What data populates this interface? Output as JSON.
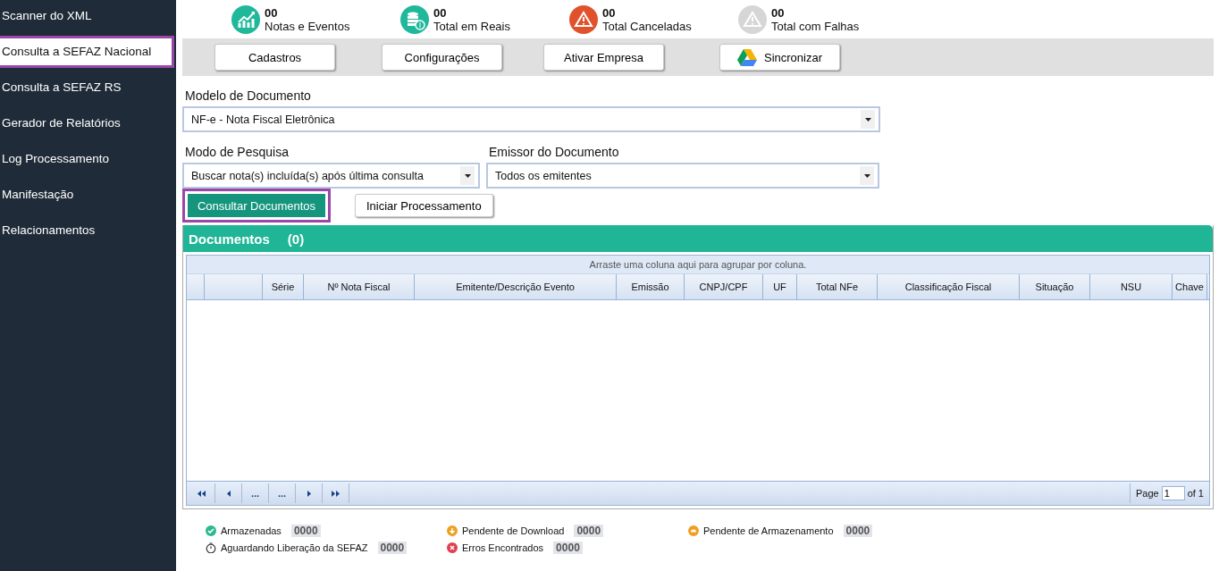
{
  "sidebar": {
    "items": [
      {
        "label": "Scanner do XML",
        "selected": false
      },
      {
        "label": "Consulta a SEFAZ Nacional",
        "selected": true
      },
      {
        "label": "Consulta a SEFAZ RS",
        "selected": false
      },
      {
        "label": "Gerador de Relatórios",
        "selected": false
      },
      {
        "label": "Log Processamento",
        "selected": false
      },
      {
        "label": "Manifestação",
        "selected": false
      },
      {
        "label": "Relacionamentos",
        "selected": false
      }
    ]
  },
  "stats": [
    {
      "kind": "chart",
      "value": "00",
      "label": "Notas e Eventos",
      "color": "#1fb89a"
    },
    {
      "kind": "coins",
      "value": "00",
      "label": "Total em Reais",
      "color": "#1fb89a"
    },
    {
      "kind": "warning",
      "value": "00",
      "label": "Total Canceladas",
      "color": "#e0522b"
    },
    {
      "kind": "warning",
      "value": "00",
      "label": "Total com Falhas",
      "color": "#d6d6d6"
    }
  ],
  "toolbar": [
    {
      "label": "Cadastros",
      "kind": "plain"
    },
    {
      "label": "Configurações",
      "kind": "plain"
    },
    {
      "label": "Ativar Empresa",
      "kind": "plain"
    },
    {
      "label": "Sincronizar",
      "kind": "drive"
    }
  ],
  "form": {
    "modelo": {
      "label": "Modelo de Documento",
      "value": "NF-e - Nota Fiscal Eletrônica"
    },
    "modo": {
      "label": "Modo de Pesquisa",
      "value": "Buscar nota(s) incluída(s) após última consulta"
    },
    "emissor": {
      "label": "Emissor do Documento",
      "value": "Todos os emitentes"
    }
  },
  "actions": [
    {
      "label": "Consultar Documentos",
      "kind": "primary"
    },
    {
      "label": "Iniciar Processamento",
      "kind": "default"
    }
  ],
  "grid": {
    "title": "Documentos",
    "count": "(0)",
    "group_hint": "Arraste uma coluna aqui para agrupar por coluna.",
    "columns": [
      "",
      "",
      "Série",
      "Nº Nota Fiscal",
      "Emitente/Descrição Evento",
      "Emissão",
      "CNPJ/CPF",
      "UF",
      "Total NFe",
      "Classificação Fiscal",
      "Situação",
      "NSU",
      "Chave"
    ],
    "pager": {
      "buttons": [
        {
          "kind": "first"
        },
        {
          "kind": "prev"
        },
        {
          "kind": "text",
          "label": "..."
        },
        {
          "kind": "text",
          "label": "..."
        },
        {
          "kind": "next"
        },
        {
          "kind": "last"
        }
      ],
      "page_label": "Page",
      "page": "1",
      "of_label": "of 1"
    }
  },
  "legend": [
    {
      "kind": "check",
      "label": "Armazenadas",
      "count": "0000",
      "color": "#2db88f"
    },
    {
      "kind": "down",
      "label": "Pendente de Download",
      "count": "0000",
      "color": "#f0a020"
    },
    {
      "kind": "ring",
      "label": "Pendente de Armazenamento",
      "count": "0000",
      "color": "#f0a020"
    },
    {
      "kind": "timer",
      "label": "Aguardando Liberação da SEFAZ",
      "count": "0000"
    },
    {
      "kind": "error",
      "label": "Erros Encontrados",
      "count": "0000",
      "color": "#e04050"
    }
  ]
}
